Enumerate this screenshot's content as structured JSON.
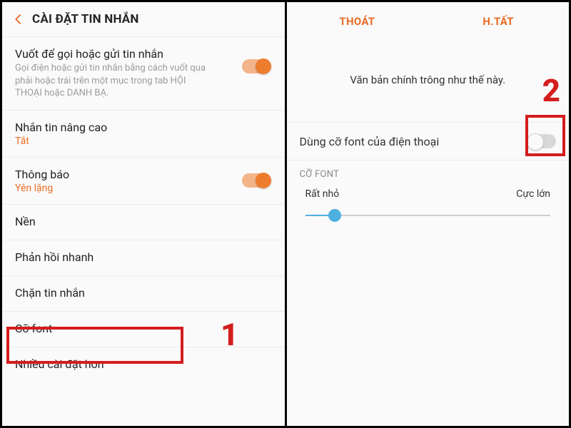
{
  "left": {
    "title": "CÀI ĐẶT TIN NHẮN",
    "rows": {
      "swipe": {
        "title": "Vuốt để gọi hoặc gửi tin nhắn",
        "sub": "Gọi điện hoặc gửi tin nhắn bằng cách vuốt qua phải hoặc trái trên một mục trong tab HỘI THOẠI hoặc DANH BẠ."
      },
      "advanced": {
        "title": "Nhắn tin nâng cao",
        "state": "Tắt"
      },
      "notify": {
        "title": "Thông báo",
        "state": "Yên lặng"
      },
      "background": {
        "title": "Nền"
      },
      "quickreply": {
        "title": "Phản hồi nhanh"
      },
      "block": {
        "title": "Chặn tin nhắn"
      },
      "fontsize": {
        "title": "Cỡ font"
      },
      "more": {
        "title": "Nhiều cài đặt hơn"
      }
    }
  },
  "right": {
    "header": {
      "exit": "THOÁT",
      "done": "H.TẤT"
    },
    "preview": "Văn bản chính trông như thế này.",
    "usePhoneFont": {
      "label": "Dùng cỡ font của điện thoại"
    },
    "sectionLabel": "CỠ FONT",
    "slider": {
      "minLabel": "Rất nhỏ",
      "maxLabel": "Cực lớn"
    }
  },
  "annotations": {
    "one": "1",
    "two": "2"
  }
}
